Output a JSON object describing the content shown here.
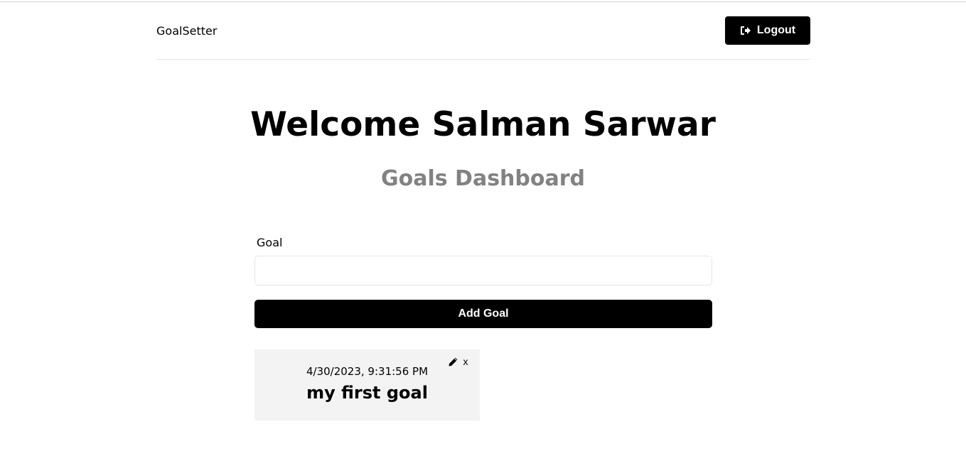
{
  "header": {
    "brand": "GoalSetter",
    "logout_label": "Logout",
    "logout_icon": "sign-out-icon"
  },
  "main": {
    "heading": "Welcome Salman Sarwar",
    "subheading": "Goals Dashboard"
  },
  "form": {
    "goal_label": "Goal",
    "goal_value": "",
    "goal_placeholder": "",
    "submit_label": "Add Goal"
  },
  "goals": [
    {
      "date": "4/30/2023, 9:31:56 PM",
      "text": "my first goal",
      "edit_icon": "pencil-icon",
      "delete_label": "x"
    }
  ],
  "colors": {
    "primary": "#000000",
    "subheading": "#828282",
    "card_bg": "#f3f3f3"
  }
}
